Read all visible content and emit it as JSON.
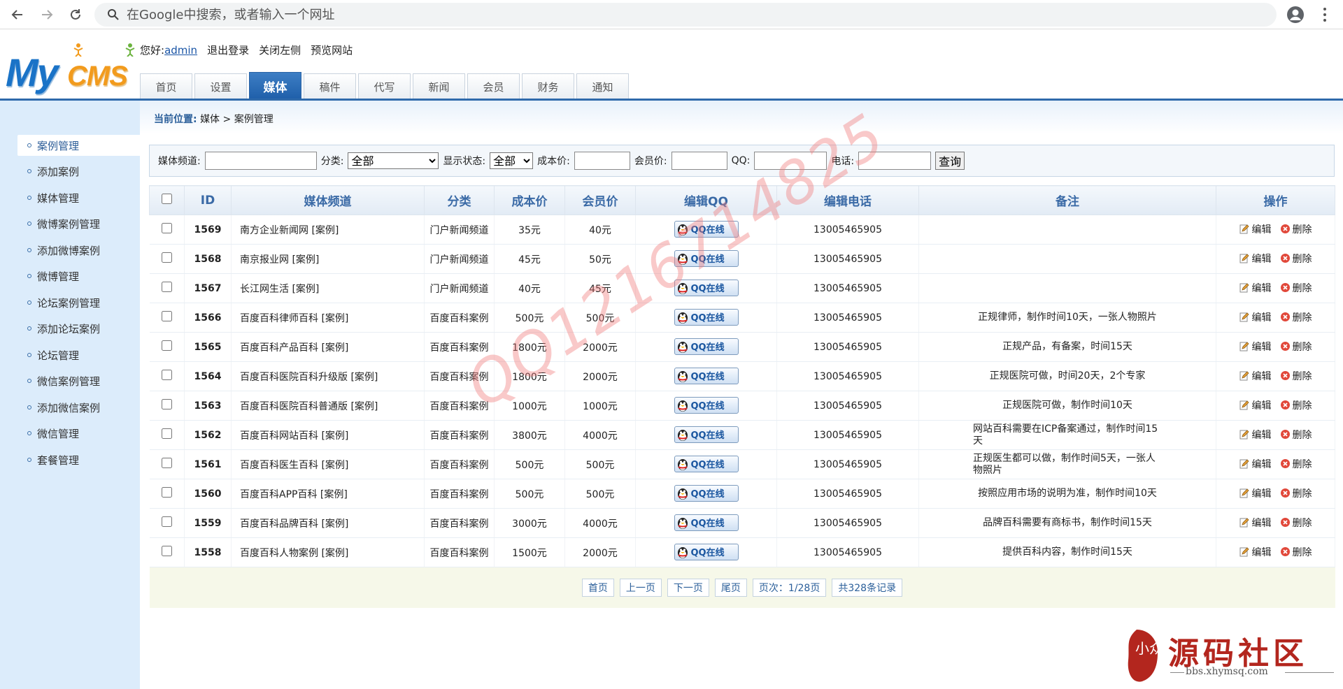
{
  "browser": {
    "address_placeholder": "在Google中搜索，或者输入一个网址"
  },
  "header": {
    "logo_my": "My",
    "logo_cms": "CMS",
    "greeting": "您好:",
    "username": "admin",
    "logout": "退出登录",
    "close_left": "关闭左侧",
    "preview": "预览网站",
    "tabs": [
      "首页",
      "设置",
      "媒体",
      "稿件",
      "代写",
      "新闻",
      "会员",
      "财务",
      "通知"
    ],
    "active_tab": "媒体"
  },
  "sidebar": {
    "items": [
      "案例管理",
      "添加案例",
      "媒体管理",
      "微博案例管理",
      "添加微博案例",
      "微博管理",
      "论坛案例管理",
      "添加论坛案例",
      "论坛管理",
      "微信案例管理",
      "添加微信案例",
      "微信管理",
      "套餐管理"
    ],
    "active": "案例管理"
  },
  "breadcrumb": {
    "label": "当前位置:",
    "path": "媒体 > 案例管理"
  },
  "search": {
    "channel_label": "媒体频道:",
    "category_label": "分类:",
    "category_value": "全部",
    "display_label": "显示状态:",
    "display_value": "全部",
    "cost_label": "成本价:",
    "member_label": "会员价:",
    "qq_label": "QQ:",
    "phone_label": "电话:",
    "submit": "查询"
  },
  "table": {
    "columns": [
      "",
      "ID",
      "媒体频道",
      "分类",
      "成本价",
      "会员价",
      "编辑QQ",
      "编辑电话",
      "备注",
      "操作"
    ],
    "qq_button": "QQ在线",
    "edit_label": "编辑",
    "delete_label": "删除",
    "rows": [
      {
        "id": "1569",
        "name": "南方企业新闻网 [案例]",
        "category": "门户新闻频道",
        "cost": "35元",
        "member": "40元",
        "phone": "13005465905",
        "note": ""
      },
      {
        "id": "1568",
        "name": "南京报业网 [案例]",
        "category": "门户新闻频道",
        "cost": "45元",
        "member": "50元",
        "phone": "13005465905",
        "note": ""
      },
      {
        "id": "1567",
        "name": "长江网生活 [案例]",
        "category": "门户新闻频道",
        "cost": "40元",
        "member": "45元",
        "phone": "13005465905",
        "note": ""
      },
      {
        "id": "1566",
        "name": "百度百科律师百科 [案例]",
        "category": "百度百科案例",
        "cost": "500元",
        "member": "500元",
        "phone": "13005465905",
        "note": "正规律师，制作时间10天，一张人物照片"
      },
      {
        "id": "1565",
        "name": "百度百科产品百科 [案例]",
        "category": "百度百科案例",
        "cost": "1800元",
        "member": "2000元",
        "phone": "13005465905",
        "note": "正规产品，有备案，时间15天"
      },
      {
        "id": "1564",
        "name": "百度百科医院百科升级版 [案例]",
        "category": "百度百科案例",
        "cost": "1800元",
        "member": "2000元",
        "phone": "13005465905",
        "note": "正规医院可做，时间20天，2个专家"
      },
      {
        "id": "1563",
        "name": "百度百科医院百科普通版 [案例]",
        "category": "百度百科案例",
        "cost": "1000元",
        "member": "1000元",
        "phone": "13005465905",
        "note": "正规医院可做，制作时间10天"
      },
      {
        "id": "1562",
        "name": "百度百科网站百科 [案例]",
        "category": "百度百科案例",
        "cost": "3800元",
        "member": "4000元",
        "phone": "13005465905",
        "note": "网站百科需要在ICP备案通过，制作时间15天"
      },
      {
        "id": "1561",
        "name": "百度百科医生百科 [案例]",
        "category": "百度百科案例",
        "cost": "500元",
        "member": "500元",
        "phone": "13005465905",
        "note": "正规医生都可以做，制作时间5天，一张人物照片"
      },
      {
        "id": "1560",
        "name": "百度百科APP百科 [案例]",
        "category": "百度百科案例",
        "cost": "500元",
        "member": "500元",
        "phone": "13005465905",
        "note": "按照应用市场的说明为准，制作时间10天"
      },
      {
        "id": "1559",
        "name": "百度百科品牌百科 [案例]",
        "category": "百度百科案例",
        "cost": "3000元",
        "member": "4000元",
        "phone": "13005465905",
        "note": "品牌百科需要有商标书，制作时间15天"
      },
      {
        "id": "1558",
        "name": "百度百科人物案例 [案例]",
        "category": "百度百科案例",
        "cost": "1500元",
        "member": "2000元",
        "phone": "13005465905",
        "note": "提供百科内容，制作时间15天"
      }
    ]
  },
  "pager": {
    "first": "首页",
    "prev": "上一页",
    "next": "下一页",
    "last": "尾页",
    "page_info": "页次：1/28页",
    "total": "共328条记录"
  },
  "watermark": "QQ1216714825",
  "forum": {
    "name": "源码社区",
    "url": "bbs.xhymsq.com",
    "seal_text": "小众"
  },
  "colors": {
    "accent": "#2f6aab",
    "sidebar_bg": "#dcecfb",
    "header_text": "#3a6aa6"
  }
}
